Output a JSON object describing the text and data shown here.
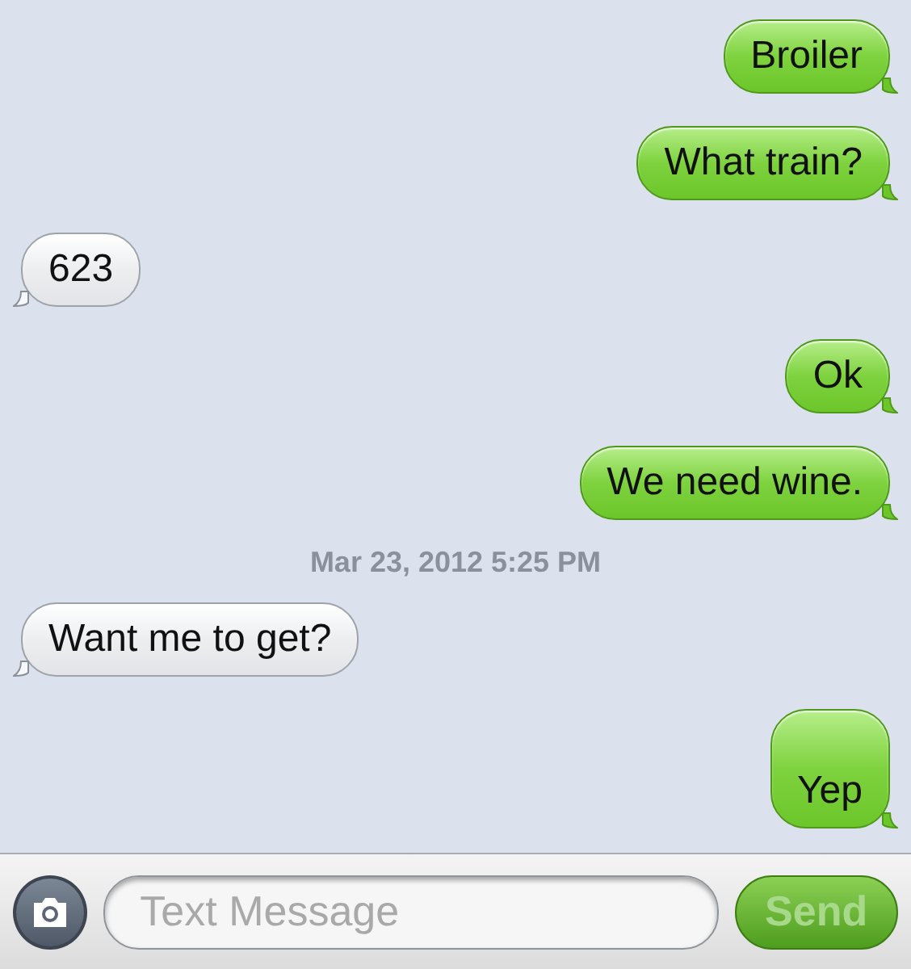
{
  "messages": [
    {
      "kind": "sent",
      "text": "Broiler"
    },
    {
      "kind": "sent",
      "text": "What train?"
    },
    {
      "kind": "received",
      "text": "623"
    },
    {
      "kind": "sent",
      "text": "Ok"
    },
    {
      "kind": "sent",
      "text": "We need wine."
    },
    {
      "kind": "timestamp",
      "text": "Mar 23, 2012 5:25 PM"
    },
    {
      "kind": "received",
      "text": "Want me to get?"
    },
    {
      "kind": "sent",
      "text": "\nYep"
    }
  ],
  "composer": {
    "placeholder": "Text Message",
    "send": {
      "label": "Send",
      "disabled": true
    }
  }
}
